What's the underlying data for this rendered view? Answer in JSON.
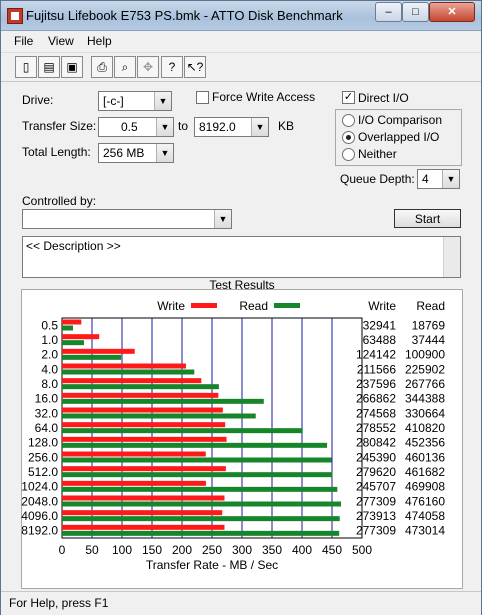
{
  "window": {
    "title": "Fujitsu Lifebook E753 PS.bmk - ATTO Disk Benchmark",
    "minimize": "–",
    "maximize": "□",
    "close": "✕"
  },
  "menu": {
    "file": "File",
    "view": "View",
    "help": "Help"
  },
  "toolbar": {
    "icons": [
      "new-icon",
      "open-icon",
      "save-icon",
      "print-icon",
      "print-preview-icon",
      "move-icon",
      "help-icon",
      "context-help-icon"
    ],
    "glyphs": [
      "▯",
      "▤",
      "▣",
      "⎙",
      "⌕",
      "✥",
      "?",
      "↖?"
    ]
  },
  "settings": {
    "drive_label": "Drive:",
    "drive_value": "[-c-]",
    "force_write_label": "Force Write Access",
    "direct_io_label": "Direct I/O",
    "direct_io_checked": "✓",
    "transfer_size_label": "Transfer Size:",
    "transfer_from": "0.5",
    "to_label": "to",
    "transfer_to": "8192.0",
    "kb_label": "KB",
    "total_length_label": "Total Length:",
    "total_length_value": "256 MB",
    "io_comparison_label": "I/O Comparison",
    "overlapped_io_label": "Overlapped I/O",
    "neither_label": "Neither",
    "queue_depth_label": "Queue Depth:",
    "queue_depth_value": "4",
    "controlled_by_label": "Controlled by:",
    "controlled_by_value": "",
    "start_label": "Start",
    "description": "<< Description >>"
  },
  "status": {
    "text": "For Help, press F1"
  },
  "chart_data": {
    "type": "bar",
    "title": "Test Results",
    "xlabel": "Transfer Rate - MB / Sec",
    "xlim": [
      0,
      500
    ],
    "x_ticks": [
      "0",
      "50",
      "100",
      "150",
      "200",
      "250",
      "300",
      "350",
      "400",
      "450",
      "500"
    ],
    "categories": [
      "0.5",
      "1.0",
      "2.0",
      "4.0",
      "8.0",
      "16.0",
      "32.0",
      "64.0",
      "128.0",
      "256.0",
      "512.0",
      "1024.0",
      "2048.0",
      "4096.0",
      "8192.0"
    ],
    "series": [
      {
        "name": "Write",
        "color": "#ff1a1a",
        "values": [
          32.2,
          62.0,
          121.2,
          206.6,
          232.2,
          260.6,
          268.1,
          272.0,
          274.3,
          239.6,
          273.1,
          239.9,
          270.8,
          267.0,
          270.8
        ]
      },
      {
        "name": "Read",
        "color": "#17862a",
        "values": [
          18.3,
          36.6,
          98.5,
          220.5,
          261.5,
          336.3,
          322.9,
          401.2,
          441.8,
          449.4,
          450.9,
          458.9,
          465.0,
          462.9,
          462.0
        ]
      }
    ],
    "table": {
      "write_header": "Write",
      "read_header": "Read",
      "write": [
        "32941",
        "63488",
        "124142",
        "211566",
        "237596",
        "266862",
        "274568",
        "278552",
        "280842",
        "245390",
        "279620",
        "245707",
        "277309",
        "273913",
        "277309"
      ],
      "read": [
        "18769",
        "37444",
        "100900",
        "225902",
        "267766",
        "344388",
        "330664",
        "410820",
        "452356",
        "460136",
        "461682",
        "469908",
        "476160",
        "474058",
        "473014"
      ]
    }
  }
}
